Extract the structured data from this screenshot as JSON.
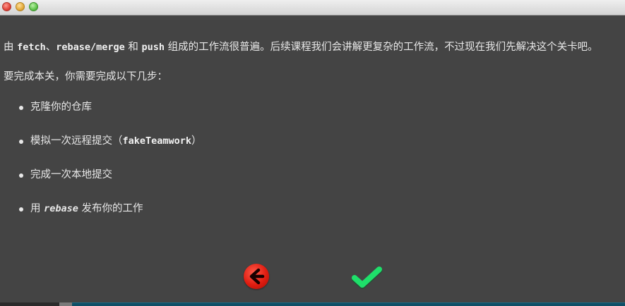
{
  "content": {
    "intro": {
      "p1": "由 ",
      "c1": "fetch",
      "p2": "、",
      "c2": "rebase/merge",
      "p3": " 和 ",
      "c3": "push",
      "p4": " 组成的工作流很普遍。后续课程我们会讲解更复杂的工作流，不过现在我们先解决这个关卡吧。"
    },
    "task_heading": "要完成本关，你需要完成以下几步：",
    "steps": [
      {
        "text": "克隆你的仓库"
      },
      {
        "pre": "模拟一次远程提交（",
        "code": "fakeTeamwork",
        "post": "）"
      },
      {
        "text": "完成一次本地提交"
      },
      {
        "pre": "用 ",
        "code": "rebase",
        "post": " 发布你的工作"
      }
    ]
  },
  "buttons": {
    "back_icon": "back-arrow-icon",
    "confirm_icon": "checkmark-icon",
    "back_color": "#e01c10",
    "confirm_color": "#1ee06a"
  }
}
